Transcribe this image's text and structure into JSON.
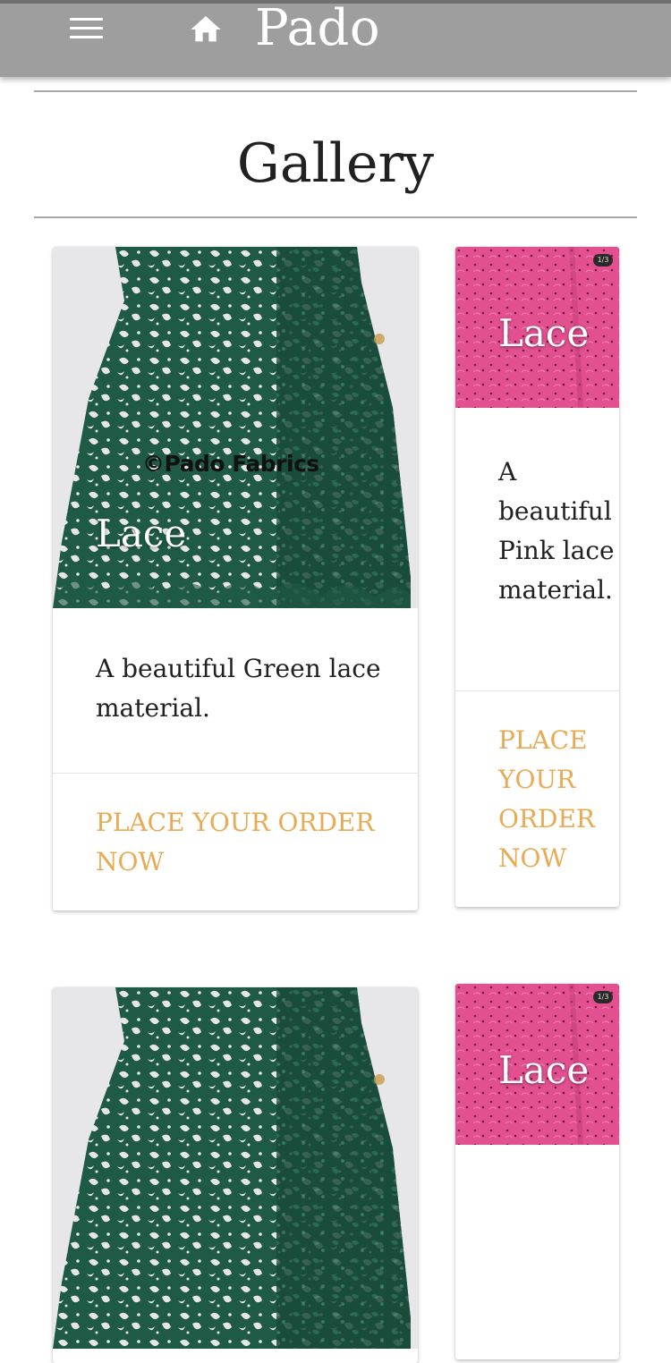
{
  "app": {
    "brand": "Pado",
    "colors": {
      "header": "#9e9e9e",
      "accent": "#e8aa52",
      "text": "#212121"
    },
    "icons": {
      "menu": "hamburger-menu-icon",
      "home": "home-icon"
    }
  },
  "page": {
    "title": "Gallery"
  },
  "cards": [
    {
      "title": "Lace",
      "image_watermark": "©Pado Fabrics",
      "description": "A beautiful Green lace material.",
      "action": "PLACE YOUR ORDER NOW"
    },
    {
      "title": "Lace",
      "image_badge": "1/3",
      "description": "A beautiful Pink lace material.",
      "action": "PLACE YOUR ORDER NOW"
    },
    {
      "title": "Lace",
      "image_badge": "1/3"
    }
  ]
}
